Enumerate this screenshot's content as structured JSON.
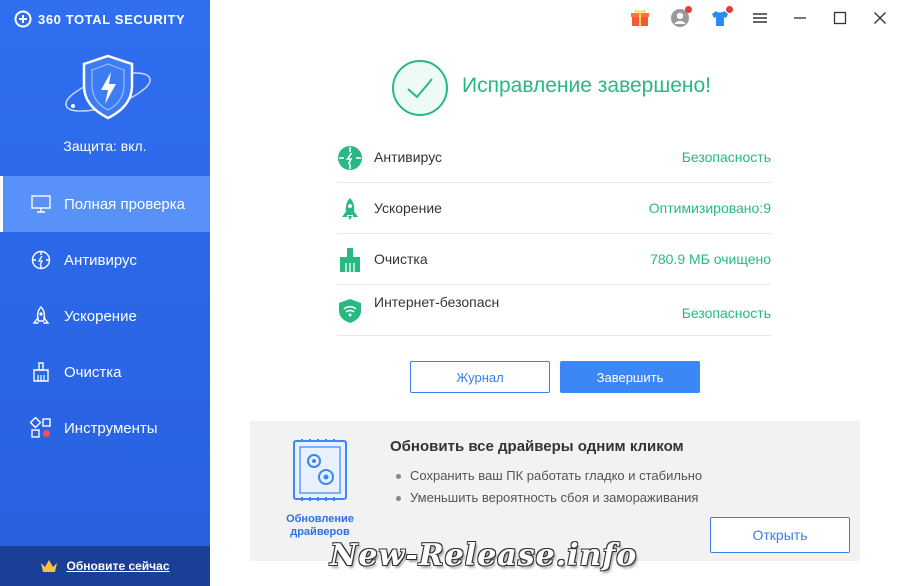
{
  "app": {
    "brand": "360 TOTAL SECURITY",
    "protection_status": "Защита: вкл."
  },
  "sidebar": {
    "items": [
      {
        "label": "Полная проверка",
        "icon": "monitor-icon",
        "active": true
      },
      {
        "label": "Антивирус",
        "icon": "antivirus-icon",
        "active": false
      },
      {
        "label": "Ускорение",
        "icon": "rocket-icon",
        "active": false
      },
      {
        "label": "Очистка",
        "icon": "broom-icon",
        "active": false
      },
      {
        "label": "Инструменты",
        "icon": "tools-icon",
        "active": false
      }
    ],
    "upgrade_label": "Обновите сейчас"
  },
  "titlebar": {
    "icons": [
      "gift-icon",
      "user-icon",
      "skin-icon",
      "menu-icon",
      "minimize-icon",
      "maximize-icon",
      "close-icon"
    ]
  },
  "result": {
    "title": "Исправление завершено!",
    "rows": [
      {
        "label": "Антивирус",
        "value": "Безопасность",
        "icon": "antivirus-icon"
      },
      {
        "label": "Ускорение",
        "value": "Оптимизировано:9",
        "icon": "rocket-icon"
      },
      {
        "label": "Очистка",
        "value": "780.9 МБ очищено",
        "icon": "broom-icon"
      },
      {
        "label": "Интернет-безопасн",
        "value": "Безопасность",
        "icon": "wifi-shield-icon"
      }
    ],
    "journal_label": "Журнал",
    "finish_label": "Завершить"
  },
  "promo": {
    "caption": "Обновление драйверов",
    "title": "Обновить все драйверы одним кликом",
    "bullets": [
      "Сохранить ваш ПК работать гладко и стабильно",
      "Уменьшить вероятность сбоя и замораживания"
    ],
    "open_label": "Открыть"
  },
  "watermark": "New-Release.info",
  "colors": {
    "sidebar": "#2f6ff0",
    "accent_green": "#27b981",
    "accent_blue": "#3a87f5"
  }
}
